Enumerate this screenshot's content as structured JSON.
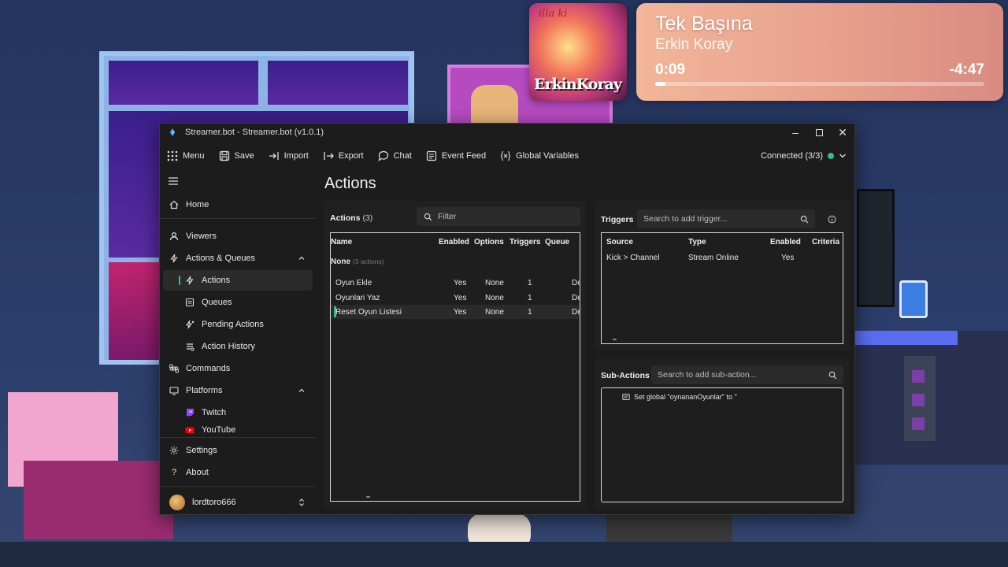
{
  "now_playing": {
    "album_art_text_top": "illa ki",
    "album_art_text_name": "ErkinKoray",
    "title": "Tek Başına",
    "artist": "Erkin Koray",
    "elapsed": "0:09",
    "remaining": "-4:47",
    "progress": 0.03
  },
  "window": {
    "title": "Streamer.bot - Streamer.bot (v1.0.1)",
    "controls": [
      "minimize",
      "maximize",
      "close"
    ]
  },
  "toolbar": {
    "menu": "Menu",
    "save": "Save",
    "import": "Import",
    "export": "Export",
    "chat": "Chat",
    "event_feed": "Event Feed",
    "global_variables": "Global Variables",
    "connection_status": "Connected (3/3)",
    "connection_color": "#2ec27e"
  },
  "sidebar": {
    "home": "Home",
    "viewers": "Viewers",
    "actions_queues": "Actions & Queues",
    "actions": "Actions",
    "queues": "Queues",
    "pending_actions": "Pending Actions",
    "action_history": "Action History",
    "commands": "Commands",
    "platforms": "Platforms",
    "twitch": "Twitch",
    "youtube": "YouTube",
    "settings": "Settings",
    "about": "About",
    "user": "lordtoro666"
  },
  "main": {
    "title": "Actions",
    "actions_panel": {
      "label": "Actions",
      "count": "(3)",
      "filter_placeholder": "Filter",
      "columns": [
        "Name",
        "Enabled",
        "Options",
        "Triggers",
        "Queue"
      ],
      "group_name": "None",
      "group_count": "(3 actions)",
      "rows": [
        {
          "name": "Oyun Ekle",
          "enabled": "Yes",
          "options": "None",
          "triggers": "1",
          "queue": "De"
        },
        {
          "name": "Oyunlari Yaz",
          "enabled": "Yes",
          "options": "None",
          "triggers": "1",
          "queue": "De"
        },
        {
          "name": "Reset Oyun Listesi",
          "enabled": "Yes",
          "options": "None",
          "triggers": "1",
          "queue": "De"
        }
      ]
    },
    "triggers_panel": {
      "label": "Triggers",
      "search_placeholder": "Search to add trigger...",
      "columns": [
        "Source",
        "Type",
        "Enabled",
        "Criteria"
      ],
      "rows": [
        {
          "source": "Kick > Channel",
          "type": "Stream Online",
          "enabled": "Yes",
          "criteria": ""
        }
      ]
    },
    "subactions_panel": {
      "label": "Sub-Actions",
      "search_placeholder": "Search to add sub-action...",
      "items": [
        "Set global \"oynananOyunlar\" to ''"
      ]
    }
  }
}
